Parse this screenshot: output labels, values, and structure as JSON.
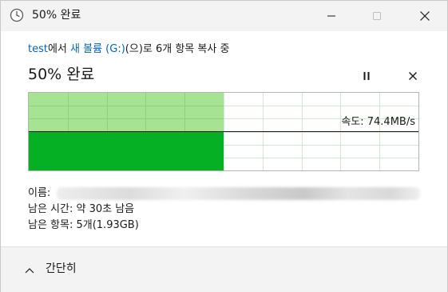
{
  "window": {
    "title": "50% 완료"
  },
  "transfer": {
    "source": "test",
    "from_suffix": "에서 ",
    "destination": "새 볼륨 (G:)",
    "to_suffix": "(으)로 6개 항목 복사 중",
    "percent_title": "50% 완료",
    "progress_fraction": 0.5
  },
  "graph": {
    "speed_label": "속도: 74.4MB/s",
    "fill_color": "#06b025",
    "history_color": "#a6e392",
    "grid_color": "#cfe9d3"
  },
  "details": {
    "name_label": "이름:",
    "time_remaining": "남은 시간: 약 30초 남음",
    "items_remaining": "남은 항목: 5개(1.93GB)"
  },
  "footer": {
    "collapse_label": "간단히"
  },
  "icons": {
    "title": "clock-icon",
    "minimize": "minimize-icon",
    "maximize": "maximize-icon",
    "close": "close-icon",
    "pause": "pause-icon",
    "cancel": "cancel-icon",
    "collapse": "chevron-up-icon"
  }
}
